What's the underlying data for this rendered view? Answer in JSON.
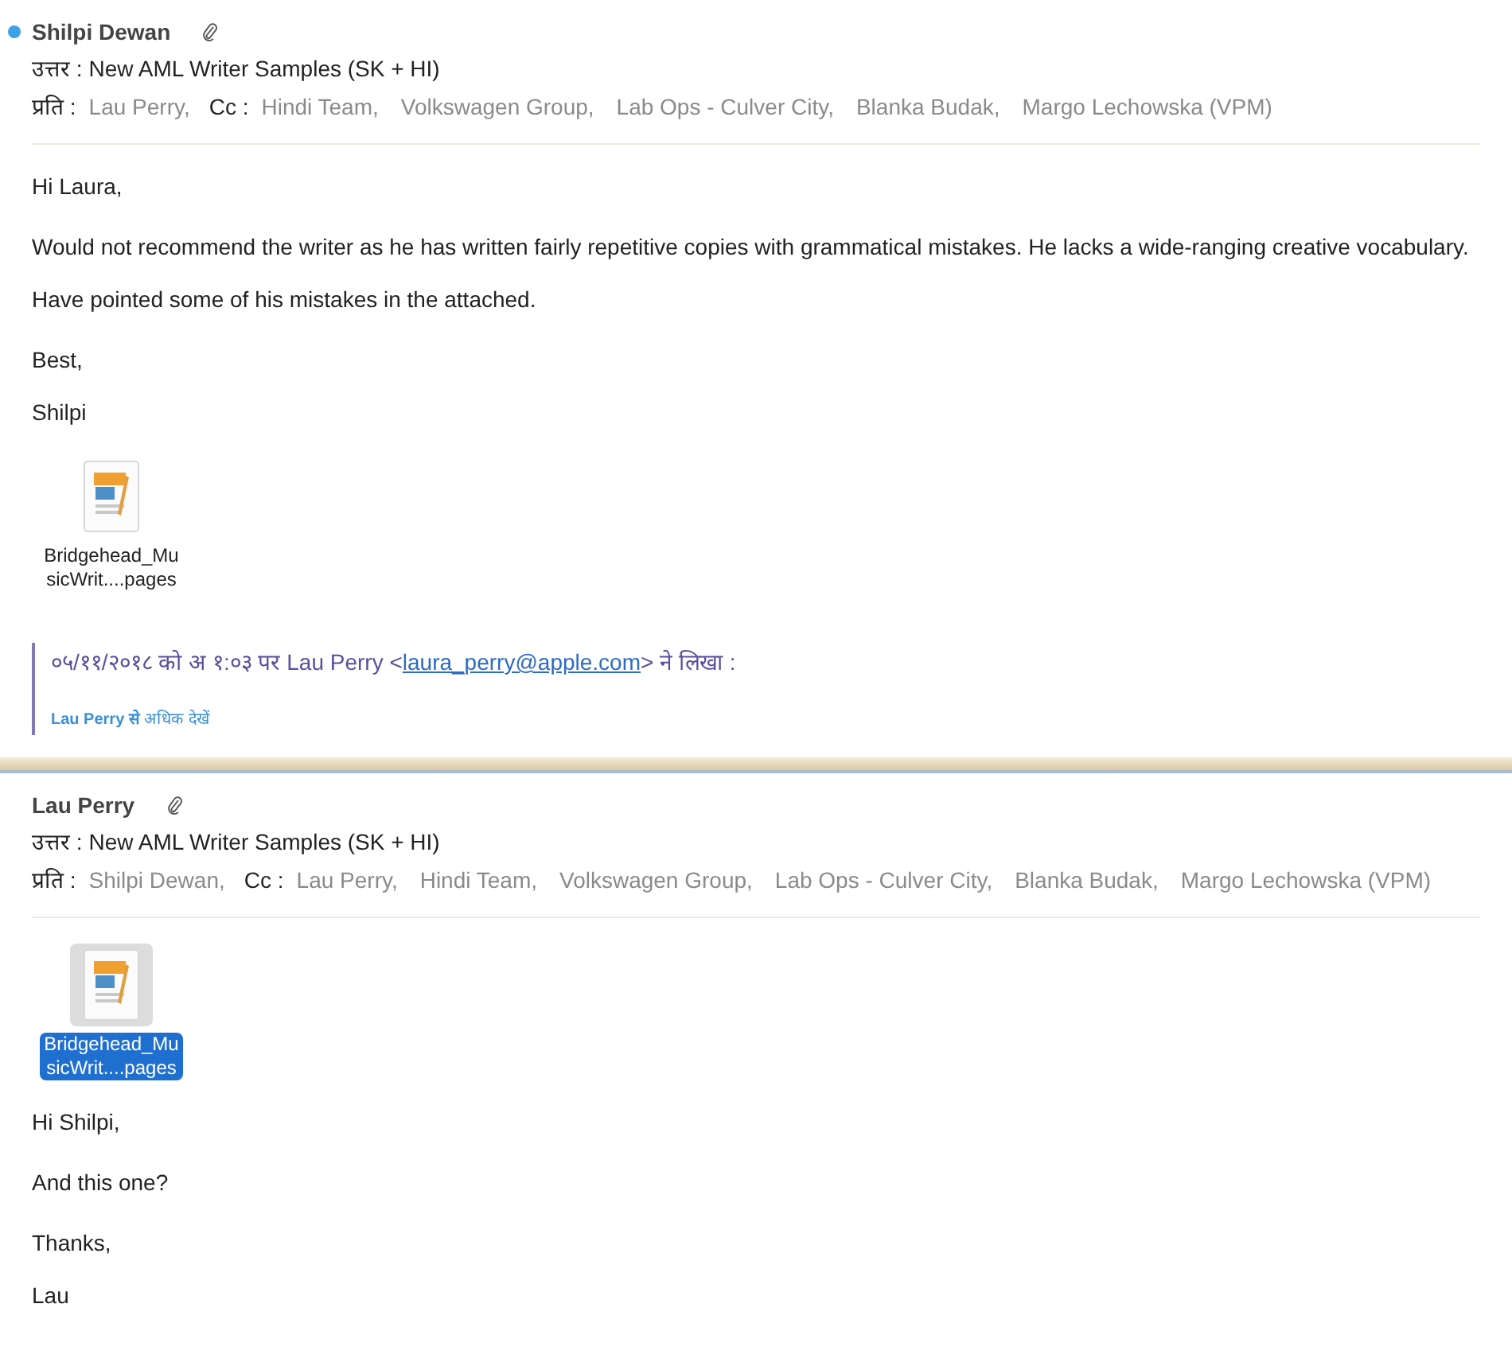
{
  "messages": [
    {
      "sender": "Shilpi Dewan",
      "unread": true,
      "has_attachment": true,
      "subject_label": "उत्तर :",
      "subject": "New AML Writer Samples (SK + HI)",
      "to_label": "प्रति :",
      "to": [
        "Lau Perry,"
      ],
      "cc_label": "Cc :",
      "cc": [
        "Hindi Team,",
        "Volkswagen Group,",
        "Lab Ops - Culver City,",
        "Blanka Budak,",
        "Margo Lechowska (VPM)"
      ],
      "body_before": [
        [
          "Hi Laura,"
        ],
        [
          "Would not recommend the writer as he has written fairly repetitive copies with grammatical mistakes. He lacks a wide-ranging creative vocabulary.",
          "Have pointed some of his mistakes in the attached."
        ],
        [
          "Best,",
          "Shilpi"
        ]
      ],
      "attachment": {
        "name_lines": [
          "Bridgehead_Mu",
          "sicWrit....pages"
        ],
        "selected": false
      },
      "quote": {
        "prefix": "०५/११/२०१८ को अ १:०३ पर Lau Perry <",
        "email": "laura_perry@apple.com",
        "suffix": "> ने लिखा :",
        "see_more": "**Lau Perry से** अधिक देखें"
      }
    },
    {
      "sender": "Lau Perry",
      "unread": false,
      "has_attachment": true,
      "subject_label": "उत्तर :",
      "subject": "New AML Writer Samples (SK + HI)",
      "to_label": "प्रति :",
      "to": [
        "Shilpi Dewan,"
      ],
      "cc_label": "Cc :",
      "cc": [
        "Lau Perry,",
        "Hindi Team,",
        "Volkswagen Group,",
        "Lab Ops - Culver City,",
        "Blanka Budak,",
        "Margo Lechowska (VPM)"
      ],
      "attachment": {
        "name_lines": [
          "Bridgehead_Mu",
          "sicWrit....pages"
        ],
        "selected": true
      },
      "body_after": [
        [
          "Hi Shilpi,"
        ],
        [
          "And this one?"
        ],
        [
          "Thanks,",
          "Lau"
        ]
      ]
    }
  ]
}
